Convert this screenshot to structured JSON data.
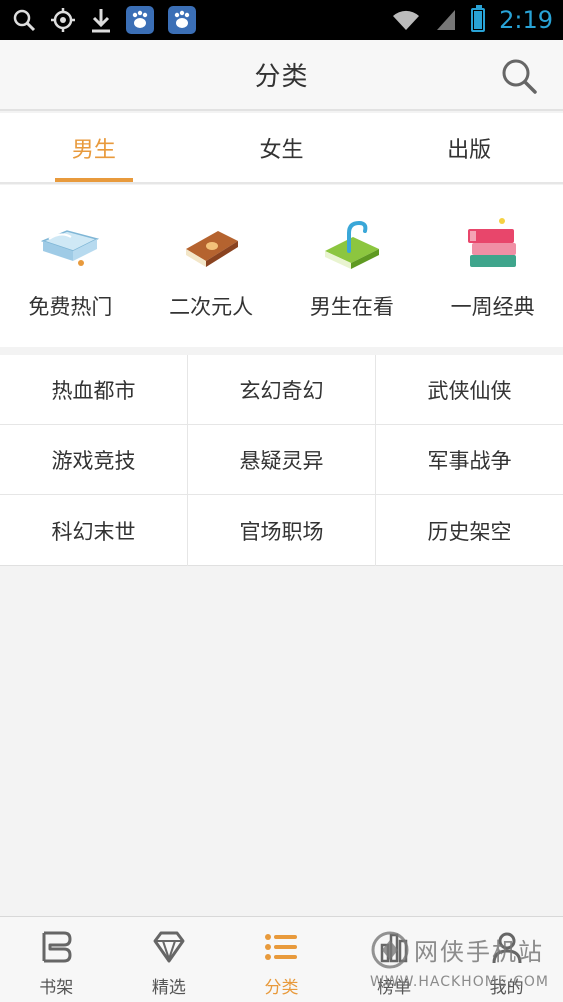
{
  "status_bar": {
    "time": "2:19",
    "icons": [
      "search-icon",
      "location-icon",
      "download-icon",
      "baidu-icon",
      "baidu-icon",
      "wifi-icon",
      "signal-icon",
      "battery-icon"
    ]
  },
  "header": {
    "title": "分类",
    "search_icon": "search-icon"
  },
  "tabs": [
    {
      "label": "男生",
      "active": true
    },
    {
      "label": "女生",
      "active": false
    },
    {
      "label": "出版",
      "active": false
    }
  ],
  "featured": [
    {
      "label": "免费热门",
      "icon": "open-book-icon"
    },
    {
      "label": "二次元人",
      "icon": "brown-book-icon"
    },
    {
      "label": "男生在看",
      "icon": "green-book-icon"
    },
    {
      "label": "一周经典",
      "icon": "book-stack-icon"
    }
  ],
  "categories": [
    "热血都市",
    "玄幻奇幻",
    "武侠仙侠",
    "游戏竞技",
    "悬疑灵异",
    "军事战争",
    "科幻末世",
    "官场职场",
    "历史架空"
  ],
  "bottom_nav": [
    {
      "label": "书架",
      "icon": "bookshelf-icon",
      "active": false
    },
    {
      "label": "精选",
      "icon": "diamond-icon",
      "active": false
    },
    {
      "label": "分类",
      "icon": "list-icon",
      "active": true
    },
    {
      "label": "榜单",
      "icon": "chart-icon",
      "active": false
    },
    {
      "label": "我的",
      "icon": "user-icon",
      "active": false
    }
  ],
  "watermark": {
    "text": "网侠手机站",
    "url": "WWW.HACKHOME.COM"
  },
  "colors": {
    "accent": "#e89a3c",
    "status_clock": "#29a3d6"
  }
}
